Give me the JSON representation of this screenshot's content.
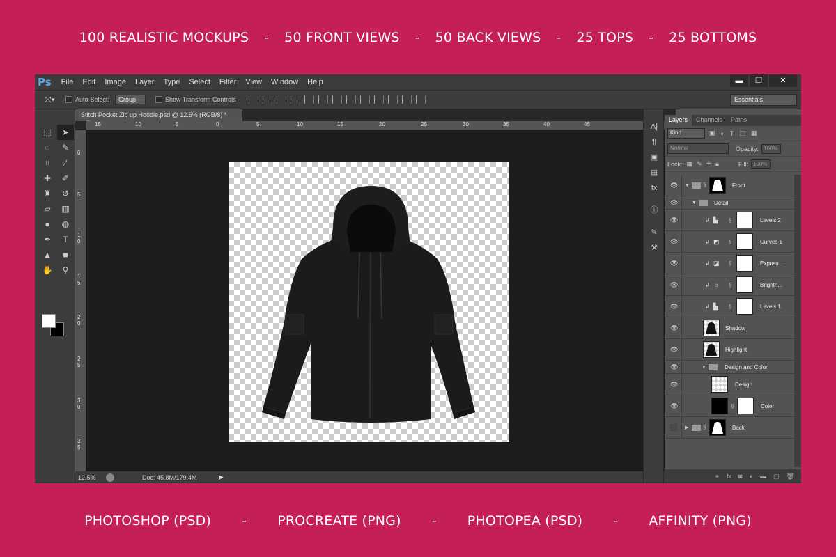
{
  "banner_top": {
    "items": [
      "100 REALISTIC MOCKUPS",
      "50 FRONT VIEWS",
      "50 BACK VIEWS",
      "25 TOPS",
      "25 BOTTOMS"
    ],
    "separator": "-"
  },
  "banner_bottom": {
    "items": [
      "PHOTOSHOP (PSD)",
      "PROCREATE (PNG)",
      "PHOTOPEA (PSD)",
      "AFFINITY (PNG)"
    ],
    "separator": "-"
  },
  "app": {
    "logo": "Ps",
    "menu": [
      "File",
      "Edit",
      "Image",
      "Layer",
      "Type",
      "Select",
      "Filter",
      "View",
      "Window",
      "Help"
    ],
    "window_controls": [
      "▬",
      "❐",
      "✕"
    ]
  },
  "options": {
    "auto_select_label": "Auto-Select:",
    "group_value": "Group",
    "transform_label": "Show Transform Controls",
    "workspace": "Essentials"
  },
  "document": {
    "tab_title": "Stitch Pocket Zip up Hoodie.psd @ 12.5% (RGB/8) *",
    "close": "×",
    "ruler_h": [
      "15",
      "10",
      "5",
      "0",
      "5",
      "10",
      "15",
      "20",
      "25",
      "30",
      "35",
      "40",
      "45"
    ],
    "ruler_v": [
      "0",
      "5",
      "1 0",
      "1 5",
      "2 0",
      "2 5",
      "3 0",
      "3 5"
    ],
    "zoom": "12.5%",
    "doc_size": "Doc: 45.8M/179.4M"
  },
  "layers_panel": {
    "tabs": [
      "Layers",
      "Channels",
      "Paths"
    ],
    "kind": "Kind",
    "blend_mode": "Normal",
    "opacity_label": "Opacity:",
    "opacity": "100%",
    "lock_label": "Lock:",
    "fill_label": "Fill:",
    "fill": "100%",
    "layers": [
      {
        "name": "Front"
      },
      {
        "name": "Detail"
      },
      {
        "name": "Levels 2"
      },
      {
        "name": "Curves 1"
      },
      {
        "name": "Exposu..."
      },
      {
        "name": "Brightn..."
      },
      {
        "name": "Levels 1"
      },
      {
        "name": "Shadow"
      },
      {
        "name": "Highlight"
      },
      {
        "name": "Design and Color"
      },
      {
        "name": "Design"
      },
      {
        "name": "Color"
      },
      {
        "name": "Back"
      }
    ]
  },
  "colors": {
    "background": "#c41f56",
    "ps_blue": "#5ba7e3"
  }
}
